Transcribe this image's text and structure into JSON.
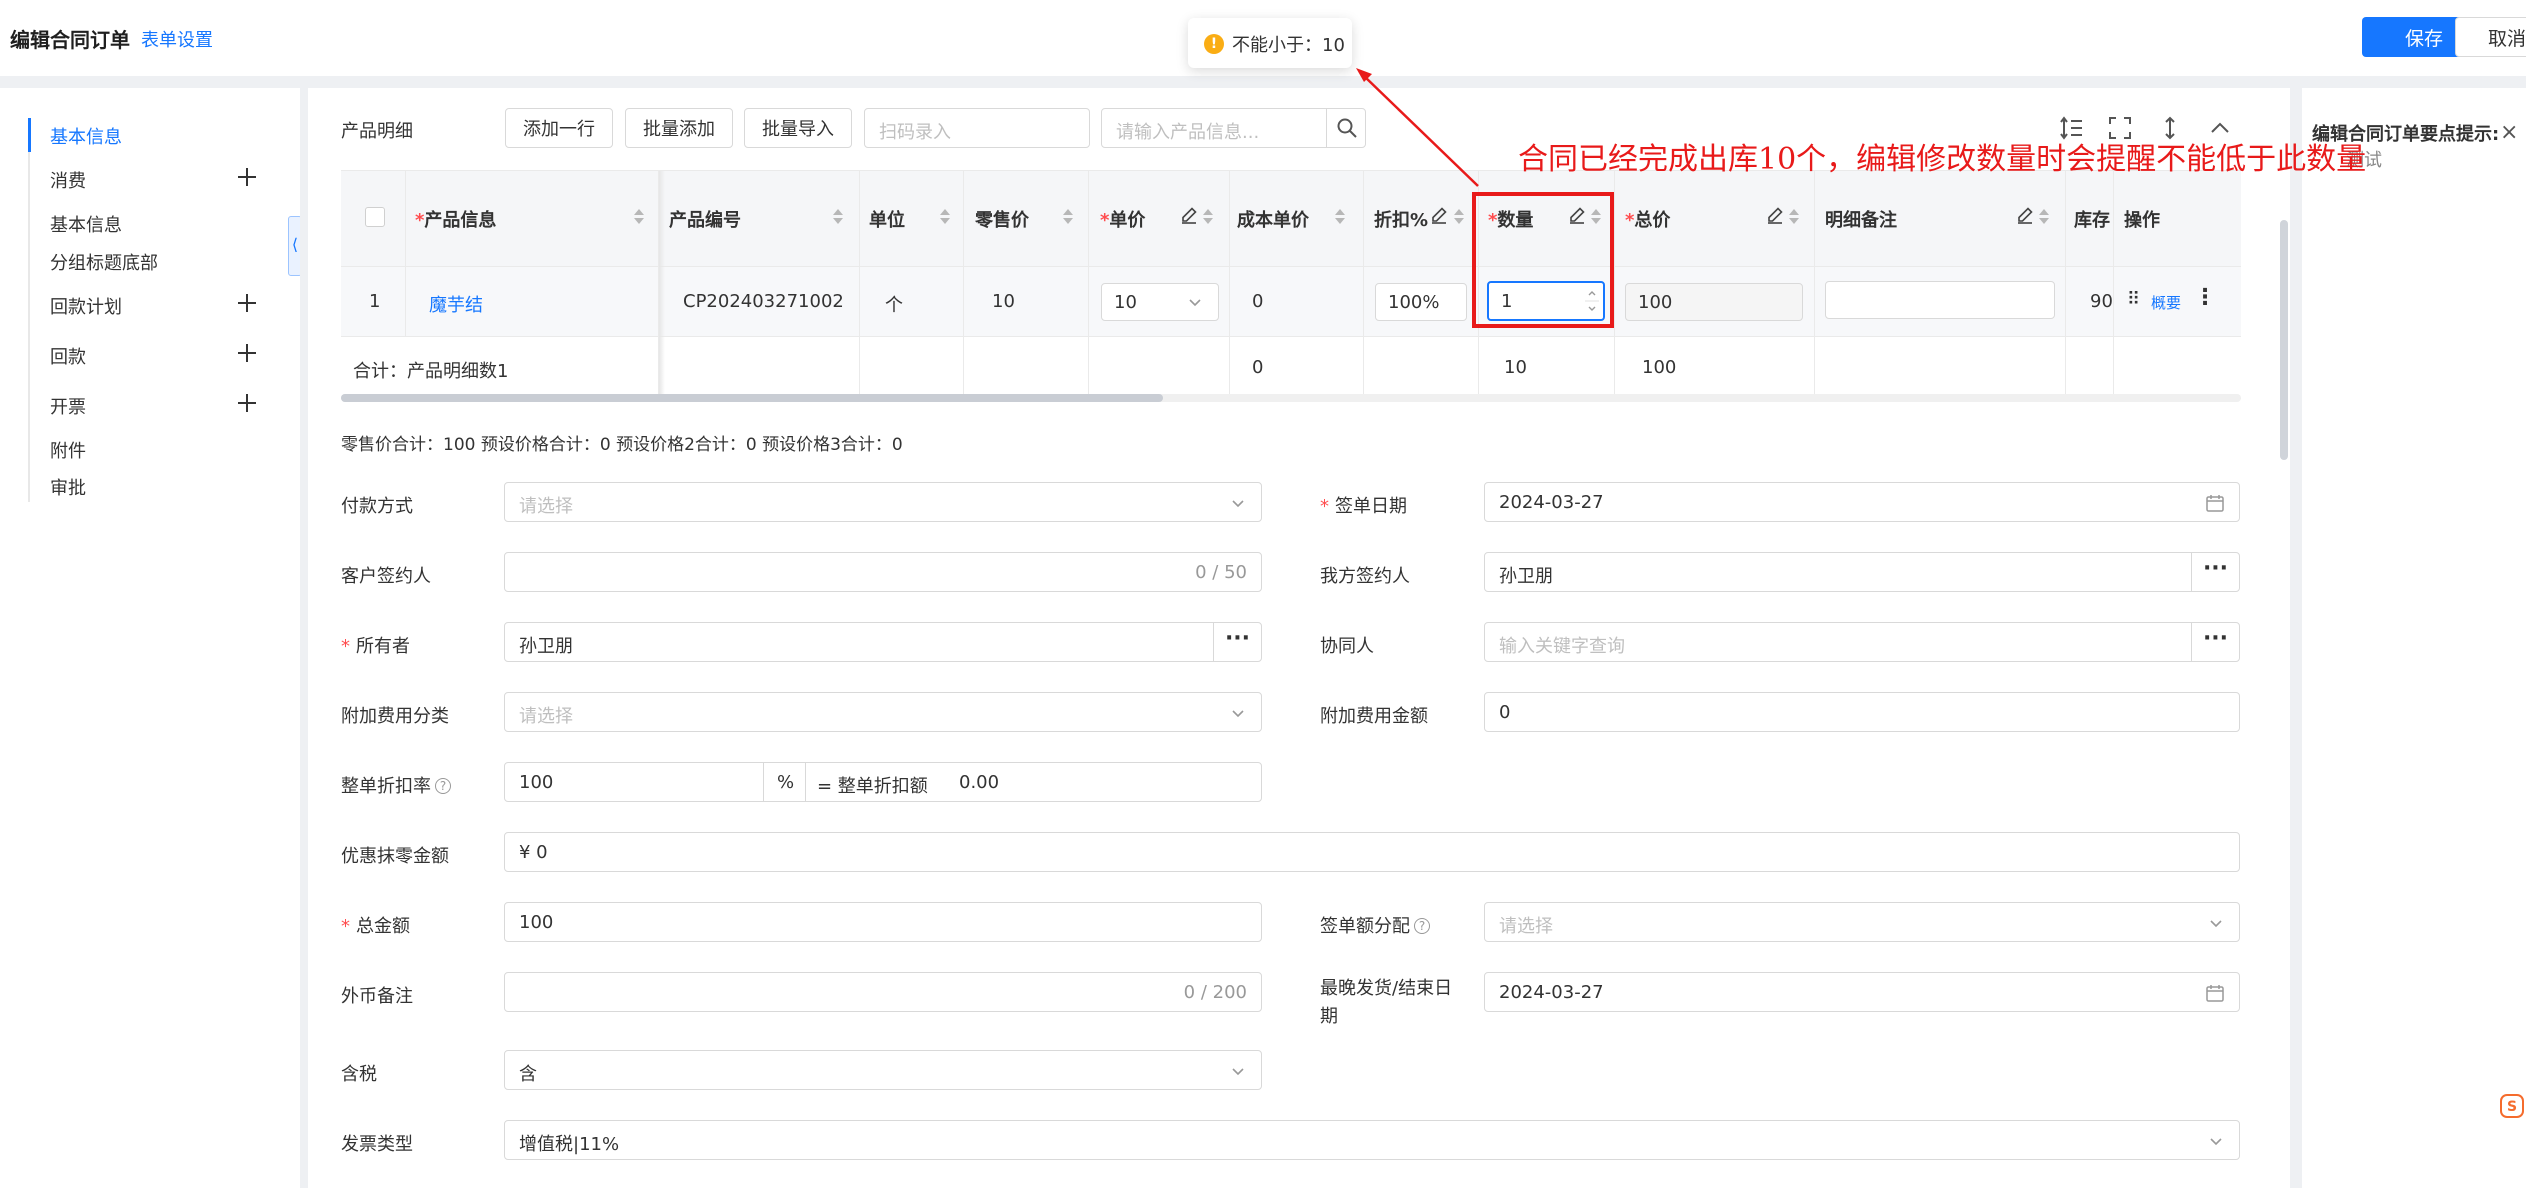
{
  "header": {
    "title": "编辑合同订单",
    "form_settings": "表单设置",
    "save_label": "保存",
    "cancel_label": "取消"
  },
  "toast": {
    "message": "不能小于：10"
  },
  "sidebar": {
    "items": [
      {
        "label": "基本信息",
        "active": true,
        "has_plus": false
      },
      {
        "label": "消费",
        "has_plus": true
      },
      {
        "label": "基本信息",
        "has_plus": false
      },
      {
        "label": "分组标题底部",
        "has_plus": false
      },
      {
        "label": "回款计划",
        "has_plus": true
      },
      {
        "label": "回款",
        "has_plus": true
      },
      {
        "label": "开票",
        "has_plus": true
      },
      {
        "label": "附件",
        "has_plus": false
      },
      {
        "label": "审批",
        "has_plus": false
      }
    ],
    "collapse_glyph": "⟨"
  },
  "product_toolbar": {
    "label": "产品明细",
    "add_row": "添加一行",
    "batch_add": "批量添加",
    "batch_import": "批量导入",
    "scan_placeholder": "扫码录入",
    "search_placeholder": "请输入产品信息..."
  },
  "annotation": {
    "text": "合同已经完成出库10个，编辑修改数量时会提醒不能低于此数量",
    "color": "#e81a1a"
  },
  "hint_panel": {
    "title": "编辑合同订单要点提示:",
    "subtitle": "测试",
    "close": "×"
  },
  "table": {
    "columns": [
      {
        "label": "",
        "required": false
      },
      {
        "label": "产品信息",
        "required": true
      },
      {
        "label": "产品编号",
        "required": false
      },
      {
        "label": "单位",
        "required": false
      },
      {
        "label": "零售价",
        "required": false
      },
      {
        "label": "单价",
        "required": true
      },
      {
        "label": "成本单价",
        "required": false
      },
      {
        "label": "折扣%",
        "required": false
      },
      {
        "label": "数量",
        "required": true
      },
      {
        "label": "总价",
        "required": true
      },
      {
        "label": "明细备注",
        "required": false
      },
      {
        "label": "库存",
        "required": false
      },
      {
        "label": "操作",
        "required": false
      }
    ],
    "row": {
      "index": "1",
      "product_name": "魔芋结",
      "product_code": "CP202403271002",
      "unit": "个",
      "retail_price": "10",
      "unit_price": "10",
      "cost_price": "0",
      "discount": "100%",
      "quantity": "1",
      "total": "100",
      "remark": "",
      "stock": "90",
      "op_link": "概要",
      "drag_glyph": "⠿",
      "more_glyph": "⋮"
    },
    "summary": {
      "label": "合计：产品明细数1",
      "cost_total": "0",
      "quantity_total": "10",
      "total": "100"
    }
  },
  "totals_line": "零售价合计：100  预设价格合计：0  预设价格2合计：0  预设价格3合计：0",
  "form": {
    "payment_method": {
      "label": "付款方式",
      "placeholder": "请选择"
    },
    "sign_date": {
      "label": "签单日期",
      "value": "2024-03-27",
      "required": true
    },
    "customer_signer": {
      "label": "客户签约人",
      "counter": "0 / 50"
    },
    "our_signer": {
      "label": "我方签约人",
      "value": "孙卫朋"
    },
    "owner": {
      "label": "所有者",
      "value": "孙卫朋",
      "required": true
    },
    "collaborator": {
      "label": "协同人",
      "placeholder": "输入关键字查询"
    },
    "extra_fee_type": {
      "label": "附加费用分类",
      "placeholder": "请选择"
    },
    "extra_fee_amount": {
      "label": "附加费用金额",
      "value": "0"
    },
    "discount_rate": {
      "label": "整单折扣率",
      "value": "100",
      "unit": "%",
      "amount_label": "= 整单折扣额",
      "amount_value": "0.00"
    },
    "rounding": {
      "label": "优惠抹零金额",
      "value": "¥ 0"
    },
    "total_amount": {
      "label": "总金额",
      "value": "100",
      "required": true
    },
    "sign_amount_dist": {
      "label": "签单额分配",
      "placeholder": "请选择"
    },
    "fx_remark": {
      "label": "外币备注",
      "counter": "0 / 200"
    },
    "latest_ship_date": {
      "label_line1": "最晚发货/结束日",
      "label_line2": "期",
      "value": "2024-03-27"
    },
    "tax_included": {
      "label": "含税",
      "value": "含"
    },
    "invoice_type": {
      "label": "发票类型",
      "value": "增值税|11%"
    }
  },
  "dots_glyph": "···",
  "help_glyph": "?",
  "warn_glyph": "!",
  "colors": {
    "primary": "#1677ff",
    "required": "#ff4d4f",
    "warning": "#faad14",
    "annotation": "#e81a1a"
  },
  "icons": [
    "warning-icon",
    "plus-icon",
    "search-icon",
    "pencil-icon",
    "sort-icon",
    "chevron-down-icon",
    "calendar-icon",
    "more-icon",
    "drag-icon",
    "close-icon",
    "help-icon",
    "row-height-icon",
    "fullscreen-icon",
    "expand-vertical-icon",
    "collapse-up-icon"
  ]
}
